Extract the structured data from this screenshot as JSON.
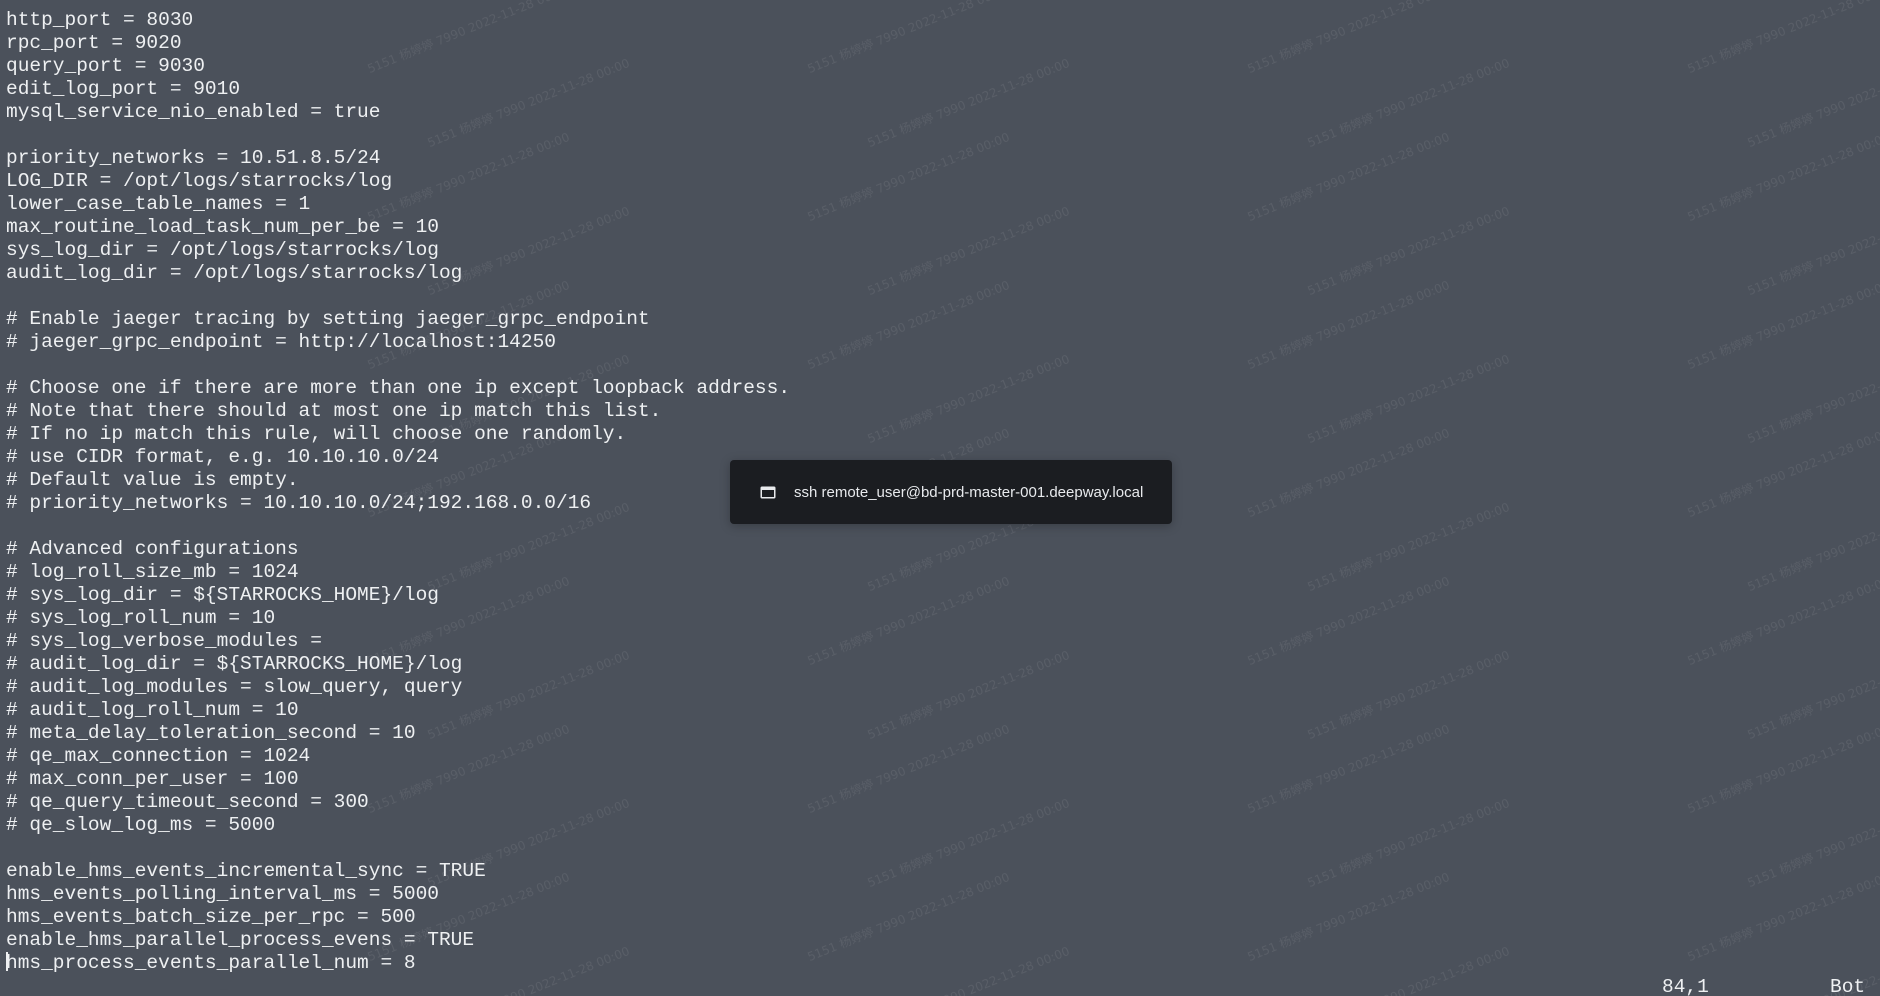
{
  "editor": {
    "lines": [
      "http_port = 8030",
      "rpc_port = 9020",
      "query_port = 9030",
      "edit_log_port = 9010",
      "mysql_service_nio_enabled = true",
      "",
      "priority_networks = 10.51.8.5/24",
      "LOG_DIR = /opt/logs/starrocks/log",
      "lower_case_table_names = 1",
      "max_routine_load_task_num_per_be = 10",
      "sys_log_dir = /opt/logs/starrocks/log",
      "audit_log_dir = /opt/logs/starrocks/log",
      "",
      "# Enable jaeger tracing by setting jaeger_grpc_endpoint",
      "# jaeger_grpc_endpoint = http://localhost:14250",
      "",
      "# Choose one if there are more than one ip except loopback address.",
      "# Note that there should at most one ip match this list.",
      "# If no ip match this rule, will choose one randomly.",
      "# use CIDR format, e.g. 10.10.10.0/24",
      "# Default value is empty.",
      "# priority_networks = 10.10.10.0/24;192.168.0.0/16",
      "",
      "# Advanced configurations",
      "# log_roll_size_mb = 1024",
      "# sys_log_dir = ${STARROCKS_HOME}/log",
      "# sys_log_roll_num = 10",
      "# sys_log_verbose_modules =",
      "# audit_log_dir = ${STARROCKS_HOME}/log",
      "# audit_log_modules = slow_query, query",
      "# audit_log_roll_num = 10",
      "# meta_delay_toleration_second = 10",
      "# qe_max_connection = 1024",
      "# max_conn_per_user = 100",
      "# qe_query_timeout_second = 300",
      "# qe_slow_log_ms = 5000",
      "",
      "enable_hms_events_incremental_sync = TRUE",
      "hms_events_polling_interval_ms = 5000",
      "hms_events_batch_size_per_rpc = 500",
      "enable_hms_parallel_process_evens = TRUE",
      "hms_process_events_parallel_num = 8"
    ]
  },
  "status": {
    "position": "84,1",
    "scroll": "Bot"
  },
  "notification": {
    "icon": "window-icon",
    "text": "ssh remote_user@bd-prd-master-001.deepway.local"
  },
  "watermark": {
    "text": "5151 杨婷婷 7990 2022-11-28 00:00"
  },
  "colors": {
    "background": "#4b515b",
    "foreground": "#eef0f2",
    "notification_bg": "#1b1d21"
  }
}
